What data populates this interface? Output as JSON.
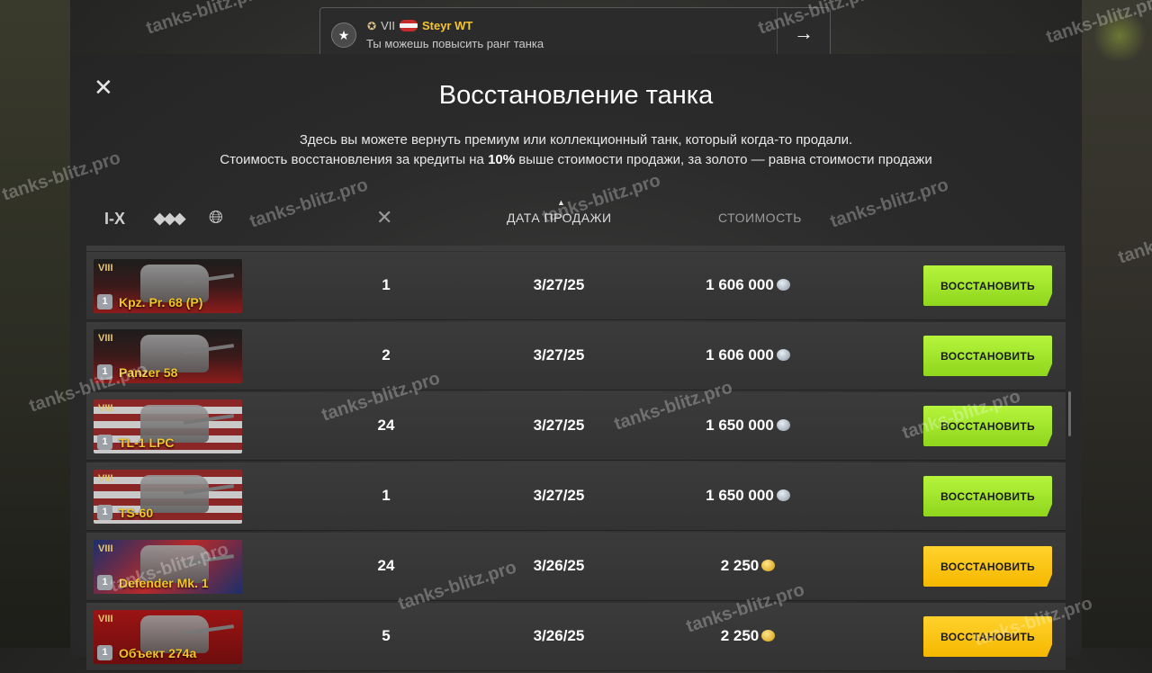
{
  "notification": {
    "rank_tier": "VII",
    "tank_name": "Steyr WT",
    "message": "Ты можешь повысить ранг танка"
  },
  "modal": {
    "title": "Восстановление танка",
    "description_line1": "Здесь вы можете вернуть премиум или коллекционный танк, который когда-то продали.",
    "description_line2_pre": "Стоимость восстановления за кредиты на ",
    "description_line2_bold": "10%",
    "description_line2_post": " выше стоимости продажи, за золото — равна стоимости продажи"
  },
  "filters": {
    "tier": "I-X",
    "type_icon": "vehicle-type-icon",
    "nation_icon": "globe-icon",
    "battles_icon": "crossed-guns-icon"
  },
  "columns": {
    "date": "ДАТА ПРОДАЖИ",
    "cost": "СТОИМОСТЬ"
  },
  "button_label": "ВОССТАНОВИТЬ",
  "colors": {
    "green_button": "#a6e82e",
    "yellow_button": "#ffc814",
    "tank_name": "#f4c327"
  },
  "tanks": [
    {
      "tier": "VIII",
      "name": "Kpz. Pr. 68 (P)",
      "mark": "1",
      "nation": "germany",
      "battles": "1",
      "date": "3/27/25",
      "cost": "1 606 000",
      "currency": "credits"
    },
    {
      "tier": "VIII",
      "name": "Panzer 58",
      "mark": "1",
      "nation": "germany",
      "battles": "2",
      "date": "3/27/25",
      "cost": "1 606 000",
      "currency": "credits"
    },
    {
      "tier": "VIII",
      "name": "TL-1 LPC",
      "mark": "1",
      "nation": "usa",
      "battles": "24",
      "date": "3/27/25",
      "cost": "1 650 000",
      "currency": "credits"
    },
    {
      "tier": "VIII",
      "name": "TS-60",
      "mark": "1",
      "nation": "usa",
      "battles": "1",
      "date": "3/27/25",
      "cost": "1 650 000",
      "currency": "credits"
    },
    {
      "tier": "VIII",
      "name": "Defender Mk. 1",
      "mark": "1",
      "nation": "uk",
      "battles": "24",
      "date": "3/26/25",
      "cost": "2 250",
      "currency": "gold"
    },
    {
      "tier": "VIII",
      "name": "Объект 274а",
      "mark": "1",
      "nation": "ussr",
      "battles": "5",
      "date": "3/26/25",
      "cost": "2 250",
      "currency": "gold"
    }
  ],
  "watermark": "tanks-blitz.pro"
}
